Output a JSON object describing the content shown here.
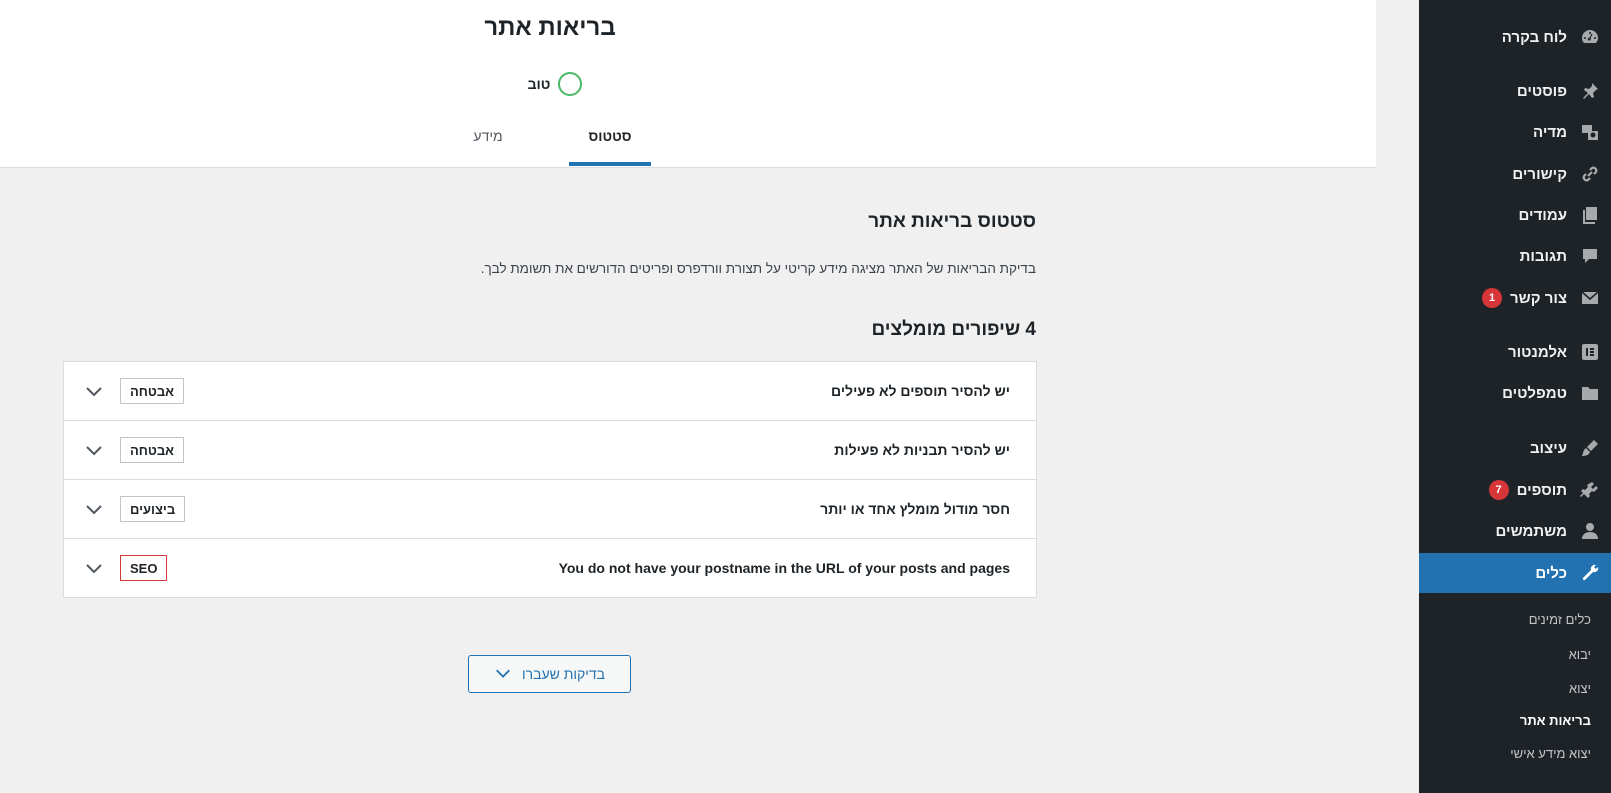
{
  "header": {
    "title": "בריאות אתר",
    "status_label": "טוב",
    "tabs": [
      {
        "label": "סטטוס",
        "active": true
      },
      {
        "label": "מידע",
        "active": false
      }
    ]
  },
  "main": {
    "section_title": "סטטוס בריאות אתר",
    "section_description": "בדיקת הבריאות של האתר מציגה מידע קריטי על תצורת וורדפרס ופריטים הדורשים את תשומת לבך.",
    "issues_title": "4 שיפורים מומלצים",
    "issues": [
      {
        "label": "יש להסיר תוספים לא פעילים",
        "badge": "אבטחה",
        "badge_color": "#c3c4c7"
      },
      {
        "label": "יש להסיר תבניות לא פעילות",
        "badge": "אבטחה",
        "badge_color": "#c3c4c7"
      },
      {
        "label": "חסר מודול מומלץ אחד או יותר",
        "badge": "ביצועים",
        "badge_color": "#c3c4c7"
      },
      {
        "label": "You do not have your postname in the URL of your posts and pages",
        "badge": "SEO",
        "badge_color": "#d63638"
      }
    ],
    "passed_button": "בדיקות שעברו"
  },
  "sidebar": {
    "items": [
      {
        "label": "לוח בקרה",
        "icon": "dashboard-icon"
      },
      {
        "label": "פוסטים",
        "icon": "pin-icon"
      },
      {
        "label": "מדיה",
        "icon": "media-icon"
      },
      {
        "label": "קישורים",
        "icon": "link-icon"
      },
      {
        "label": "עמודים",
        "icon": "pages-icon"
      },
      {
        "label": "תגובות",
        "icon": "comments-icon"
      },
      {
        "label": "צור קשר",
        "icon": "mail-icon",
        "badge": "1"
      },
      {
        "label": "אלמנטור",
        "icon": "elementor-icon"
      },
      {
        "label": "טמפלטים",
        "icon": "folder-icon"
      },
      {
        "label": "עיצוב",
        "icon": "brush-icon"
      },
      {
        "label": "תוספים",
        "icon": "plugin-icon",
        "badge": "7"
      },
      {
        "label": "משתמשים",
        "icon": "user-icon"
      },
      {
        "label": "כלים",
        "icon": "wrench-icon",
        "current": true
      }
    ],
    "submenu": [
      {
        "label": "כלים זמינים"
      },
      {
        "label": "יבוא"
      },
      {
        "label": "יצוא"
      },
      {
        "label": "בריאות אתר",
        "active": true
      },
      {
        "label": "יצוא מידע אישי"
      }
    ]
  },
  "colors": {
    "sidebar_bg": "#1d2327",
    "accent": "#2271b1",
    "status_good": "#4ab866",
    "badge_red": "#d63638"
  }
}
